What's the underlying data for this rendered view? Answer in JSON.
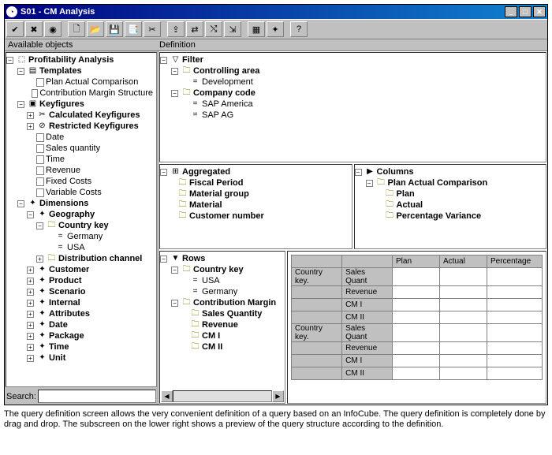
{
  "window": {
    "title": "S01 - CM Analysis"
  },
  "panels": {
    "available": "Available objects",
    "definition": "Definition",
    "search": "Search:"
  },
  "left_tree": {
    "root": "Profitability Analysis",
    "templates": "Templates",
    "t1": "Plan Actual Comparison",
    "t2": "Contribution Margin Structure",
    "keyfigures": "Keyfigures",
    "calc": "Calculated Keyfigures",
    "restr": "Restricted Keyfigures",
    "k1": "Date",
    "k2": "Sales quantity",
    "k3": "Time",
    "k4": "Revenue",
    "k5": "Fixed Costs",
    "k6": "Variable Costs",
    "dims": "Dimensions",
    "geo": "Geography",
    "ck": "Country key",
    "ck1": "Germany",
    "ck2": "USA",
    "dist": "Distribution channel",
    "cust": "Customer",
    "prod": "Product",
    "scen": "Scenario",
    "intn": "Internal",
    "attr": "Attributes",
    "date": "Date",
    "pack": "Package",
    "time": "Time",
    "unit": "Unit"
  },
  "filter": {
    "root": "Filter",
    "ca": "Controlling area",
    "ca1": "Development",
    "cc": "Company code",
    "cc1": "SAP America",
    "cc2": "SAP AG"
  },
  "agg": {
    "root": "Aggregated",
    "a1": "Fiscal Period",
    "a2": "Material group",
    "a3": "Material",
    "a4": "Customer number"
  },
  "cols": {
    "root": "Columns",
    "pac": "Plan Actual Comparison",
    "c1": "Plan",
    "c2": "Actual",
    "c3": "Percentage Variance"
  },
  "rows": {
    "root": "Rows",
    "ck": "Country key",
    "r1": "USA",
    "r2": "Germany",
    "cm": "Contribution Margin",
    "r3": "Sales Quantity",
    "r4": "Revenue",
    "r5": "CM I",
    "r6": "CM II"
  },
  "preview": {
    "h1": "Plan",
    "h2": "Actual",
    "h3": "Percentage",
    "rh": "Country key.",
    "m1": "Sales Quant",
    "m2": "Revenue",
    "m3": "CM I",
    "m4": "CM II"
  },
  "caption": "The query definition screen allows the very convenient definition of a query based on an InfoCube. The query definition is completely done by drag and drop. The subscreen on the lower right shows a preview of the query structure according to the definition."
}
